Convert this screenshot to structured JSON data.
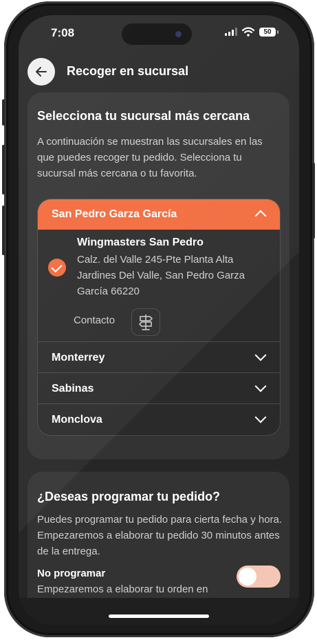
{
  "status_bar": {
    "time": "7:08",
    "battery": "50"
  },
  "header": {
    "title": "Recoger en sucursal",
    "back_icon": "arrow-left-icon"
  },
  "branch_section": {
    "title": "Selecciona tu sucursal más cercana",
    "description": "A continuación se muestran las sucursales en las que puedes recoger tu pedido. Selecciona tu sucursal más cercana o tu favorita.",
    "accordion": [
      {
        "label": "San Pedro Garza García",
        "expanded": true
      },
      {
        "label": "Monterrey",
        "expanded": false
      },
      {
        "label": "Sabinas",
        "expanded": false
      },
      {
        "label": "Monclova",
        "expanded": false
      }
    ],
    "selected_branch": {
      "name": "Wingmasters San Pedro",
      "address": "Calz. del Valle 245-Pte Planta Alta Jardines Del Valle, San Pedro Garza García 66220",
      "contact_label": "Contacto",
      "contact_icon": "signpost-icon",
      "selected": true
    }
  },
  "schedule_section": {
    "title": "¿Deseas programar tu pedido?",
    "description": "Puedes programar tu pedido para cierta fecha y hora. Empezaremos a elaborar tu pedido 30 minutos antes de la entrega.",
    "option_title": "No programar",
    "option_description": "Empezaremos a elaborar tu orden en",
    "toggle_on": false
  },
  "colors": {
    "accent": "#f26a3c",
    "card": "#333333",
    "background": "#262626"
  }
}
